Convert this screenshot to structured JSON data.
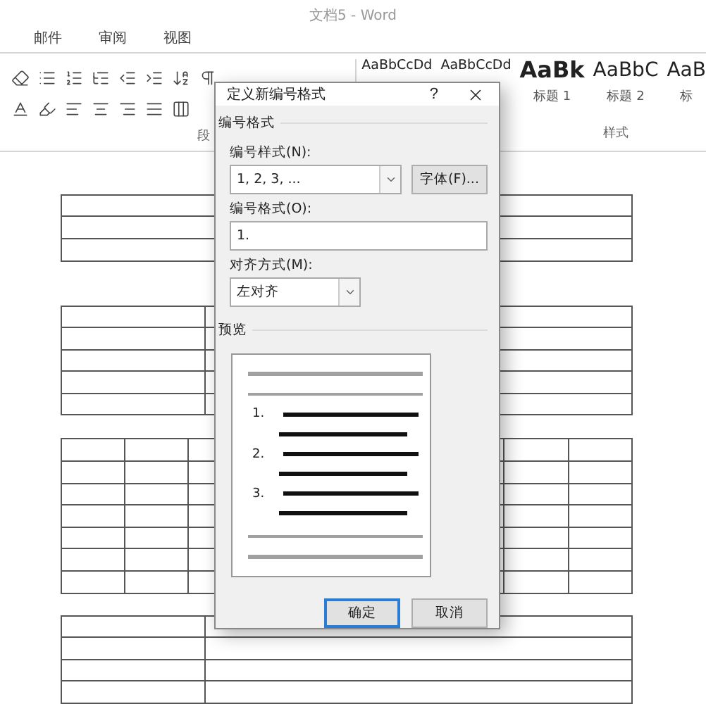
{
  "window": {
    "title": "文档5 - Word"
  },
  "tabs": [
    {
      "label": "邮件",
      "selected": false
    },
    {
      "label": "审阅",
      "selected": false
    },
    {
      "label": "视图",
      "selected": false
    }
  ],
  "ribbon": {
    "paragraph_group_label": "段",
    "styles": [
      {
        "kind": "body",
        "sample": "AaBbCcDd"
      },
      {
        "kind": "body",
        "sample": "AaBbCcDd"
      },
      {
        "kind": "heading1",
        "sample": "AaBk",
        "label": "标题 1"
      },
      {
        "kind": "heading2",
        "sample": "AaBbC",
        "label": "标题 2"
      },
      {
        "kind": "heading2",
        "sample": "AaB",
        "label": "标"
      }
    ],
    "styles_group_label": "样式"
  },
  "dialog": {
    "title": "定义新编号格式",
    "help": "?",
    "section_label": "编号格式",
    "style_label": "编号样式(N):",
    "style_value": "1, 2, 3, ...",
    "font_button": "字体(F)...",
    "format_label": "编号格式(O):",
    "format_value": "1.",
    "align_label": "对齐方式(M):",
    "align_value": "左对齐",
    "preview_label": "预览",
    "preview_numbers": [
      "1.",
      "2.",
      "3."
    ],
    "buttons": [
      {
        "label": "确定",
        "selected": true
      },
      {
        "label": "取消",
        "selected": false
      }
    ]
  }
}
